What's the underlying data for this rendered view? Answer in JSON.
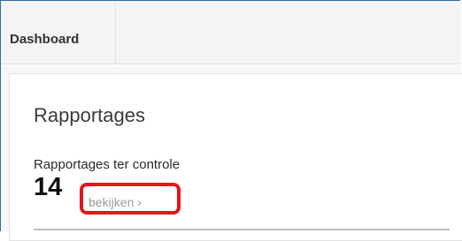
{
  "header": {
    "title": "Dashboard"
  },
  "card": {
    "title": "Rapportages",
    "subtitle": "Rapportages ter controle",
    "count": "14",
    "view_link": "bekijken ›"
  },
  "colors": {
    "frame_border": "#2e6da4",
    "highlight": "#e8141a",
    "link": "#9a9a9a"
  }
}
